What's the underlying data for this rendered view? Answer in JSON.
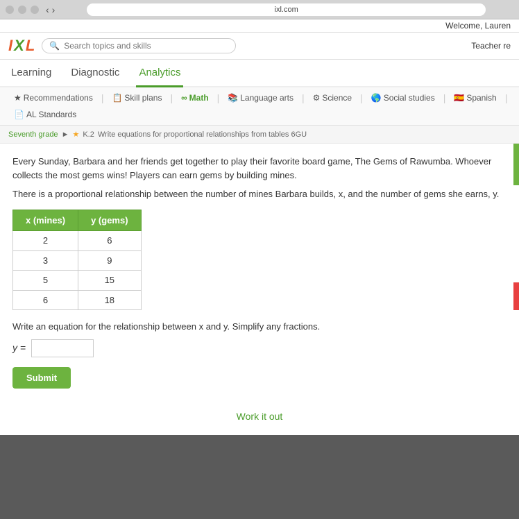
{
  "browser": {
    "url": "ixl.com",
    "welcome_text": "Welcome, Lauren"
  },
  "header": {
    "logo": "IXL",
    "search_placeholder": "Search topics and skills",
    "teacher_label": "Teacher re"
  },
  "nav": {
    "tabs": [
      {
        "label": "Learning",
        "active": false
      },
      {
        "label": "Diagnostic",
        "active": false
      },
      {
        "label": "Analytics",
        "active": true
      }
    ],
    "sub_items": [
      {
        "label": "Recommendations",
        "icon": "star"
      },
      {
        "label": "Skill plans",
        "icon": "list"
      },
      {
        "label": "Math",
        "icon": "math",
        "active": true
      },
      {
        "label": "Language arts",
        "icon": "book"
      },
      {
        "label": "Science",
        "icon": "science"
      },
      {
        "label": "Social studies",
        "icon": "globe"
      },
      {
        "label": "Spanish",
        "icon": "spanish"
      },
      {
        "label": "AL Standards",
        "icon": "standards"
      }
    ]
  },
  "breadcrumb": {
    "grade": "Seventh grade",
    "skill_code": "K.2",
    "skill_label": "Write equations for proportional relationships from tables 6GU"
  },
  "problem": {
    "intro": "Every Sunday, Barbara and her friends get together to play their favorite board game, The Gems of Rawumba. Whoever collects the most gems wins! Players can earn gems by building mines.",
    "relationship_text": "There is a proportional relationship between the number of mines Barbara builds, x, and the number of gems she earns, y.",
    "table": {
      "headers": [
        "x (mines)",
        "y (gems)"
      ],
      "rows": [
        [
          "2",
          "6"
        ],
        [
          "3",
          "9"
        ],
        [
          "5",
          "15"
        ],
        [
          "6",
          "18"
        ]
      ]
    },
    "question": "Write an equation for the relationship between x and y. Simplify any fractions.",
    "equation_prefix": "y =",
    "equation_value": "",
    "submit_label": "Submit",
    "work_it_out": "Work it out"
  }
}
